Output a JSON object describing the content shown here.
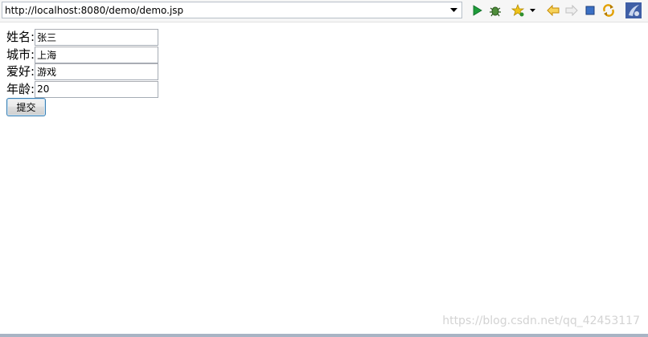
{
  "toolbar": {
    "url": "http://localhost:8080/demo/demo.jsp",
    "icons": [
      "run-icon",
      "debug-icon",
      "new-star-icon",
      "dropdown-arrow-icon",
      "back-icon",
      "forward-icon",
      "stop-icon",
      "refresh-icon",
      "eclipse-logo-icon"
    ]
  },
  "form": {
    "fields": [
      {
        "label": "姓名:",
        "value": "张三"
      },
      {
        "label": "城市:",
        "value": "上海"
      },
      {
        "label": "爱好:",
        "value": "游戏"
      },
      {
        "label": "年龄:",
        "value": "20"
      }
    ],
    "submit_label": "提交"
  },
  "watermark": "https://blog.csdn.net/qq_42453117",
  "colors": {
    "run": "#1e9b3a",
    "back": "#e0a200",
    "stop": "#3a6fc4",
    "refresh": "#e2a000",
    "button_border": "#3c7fb1"
  }
}
